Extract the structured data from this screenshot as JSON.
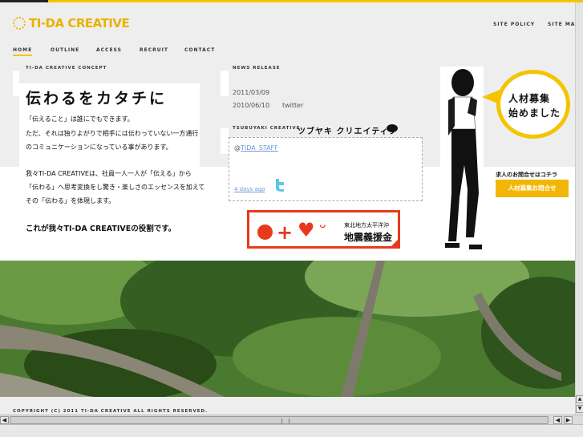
{
  "header": {
    "logo_text": "TI-DA CREATIVE",
    "util_links": [
      "SITE POLICY",
      "SITE MAP"
    ]
  },
  "nav": {
    "items": [
      "HOME",
      "OUTLINE",
      "ACCESS",
      "RECRUIT",
      "CONTACT"
    ],
    "active": "HOME"
  },
  "concept": {
    "label": "TI-DA CREATIVE CONCEPT",
    "title": "伝わるをカタチに",
    "lines": [
      "「伝えること」は誰にでもできます。",
      "ただ、それは独りよがりで相手には伝わっていない一方通行",
      "のコミュニケーションになっている事があります。",
      "我々TI-DA CREATIVEは、社員一人一人が「伝える」から",
      "「伝わる」へ思考変換をし驚き・楽しさのエッセンスを加えて",
      "その「伝わる」を体現します。"
    ],
    "closing": "これが我々TI-DA CREATIVEの役割です。"
  },
  "news": {
    "label": "NEWS RELEASE",
    "items": [
      {
        "date": "2011/03/09",
        "text": ""
      },
      {
        "date": "2010/06/10",
        "text": "twitter"
      }
    ]
  },
  "tsubuyaki": {
    "label": "TSUBUYAKI CREATIVE",
    "title": "ツブヤキ クリエイティブ",
    "user_prefix": "@",
    "user": "TIDA_STAFF",
    "ago": "4 days ago"
  },
  "quake_banner": {
    "line1": "東北地方太平洋沖",
    "line2": "地震義援金"
  },
  "recruit": {
    "bubble_line1": "人材募集",
    "bubble_line2": "始めました",
    "note": "求人のお問合せはコチラ",
    "button": "人材募集お問合せ"
  },
  "footer": {
    "copyright": "COPYRIGHT (C) 2011 TI-DA CREATIVE ALL RIGHTS RESERVED."
  },
  "colors": {
    "accent": "#f5c400",
    "logo": "#e8b200",
    "banner_red": "#e8391d"
  }
}
